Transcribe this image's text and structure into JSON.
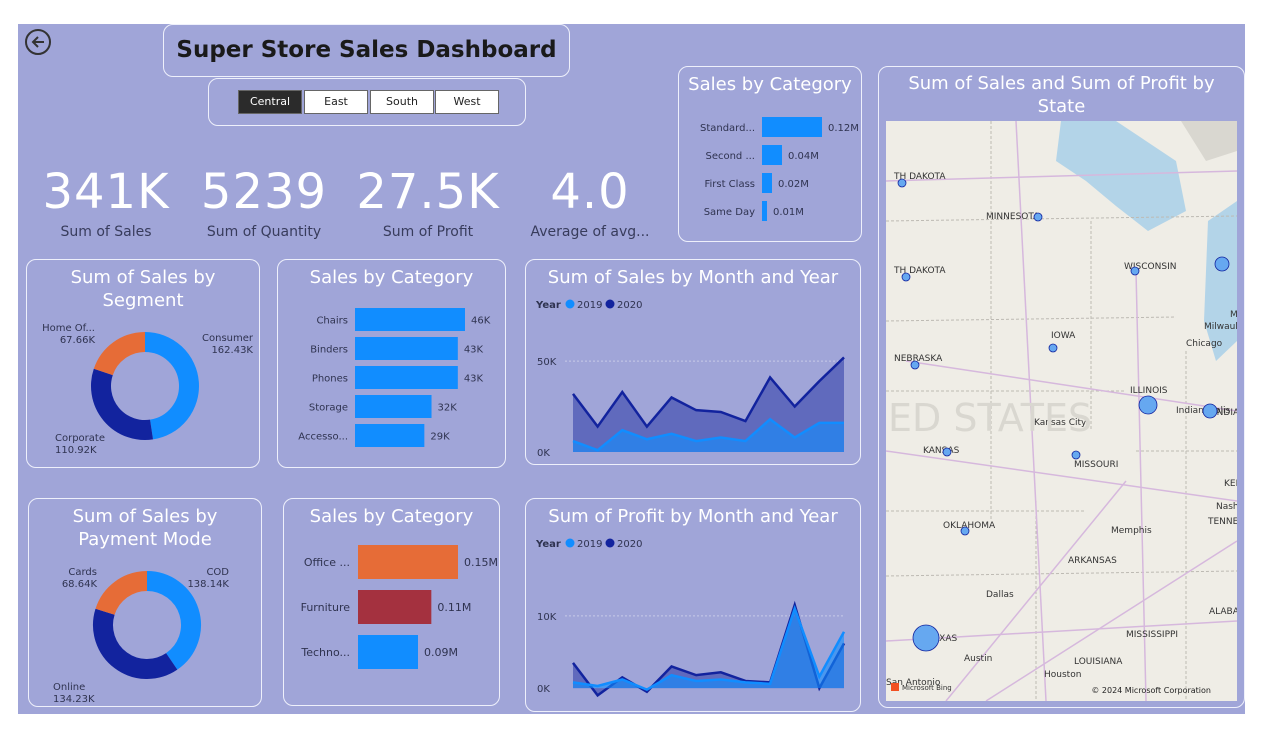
{
  "dashboard": {
    "title": "Super Store Sales Dashboard",
    "regions": [
      "Central",
      "East",
      "South",
      "West"
    ],
    "selected_region": "Central"
  },
  "kpis": [
    {
      "value": "341K",
      "label": "Sum of Sales"
    },
    {
      "value": "5239",
      "label": "Sum of Quantity"
    },
    {
      "value": "27.5K",
      "label": "Sum of Profit"
    },
    {
      "value": "4.0",
      "label": "Average of avg..."
    }
  ],
  "ship_mode": {
    "title": "Sales by Category",
    "items": [
      {
        "label": "Standard...",
        "value": 0.12,
        "text": "0.12M"
      },
      {
        "label": "Second ...",
        "value": 0.04,
        "text": "0.04M"
      },
      {
        "label": "First Class",
        "value": 0.02,
        "text": "0.02M"
      },
      {
        "label": "Same Day",
        "value": 0.01,
        "text": "0.01M"
      }
    ],
    "color": "#118dff"
  },
  "segment": {
    "title": "Sum of Sales by Segment",
    "slices": [
      {
        "name": "Consumer",
        "value": 162.43,
        "text": "162.43K",
        "color": "#118dff"
      },
      {
        "name": "Corporate",
        "value": 110.92,
        "text": "110.92K",
        "color": "#12239e"
      },
      {
        "name": "Home Of...",
        "value": 67.66,
        "text": "67.66K",
        "color": "#e66c37"
      }
    ]
  },
  "sub_category": {
    "title": "Sales by Category",
    "items": [
      {
        "label": "Chairs",
        "value": 46,
        "text": "46K"
      },
      {
        "label": "Binders",
        "value": 43,
        "text": "43K"
      },
      {
        "label": "Phones",
        "value": 43,
        "text": "43K"
      },
      {
        "label": "Storage",
        "value": 32,
        "text": "32K"
      },
      {
        "label": "Accesso...",
        "value": 29,
        "text": "29K"
      }
    ],
    "color": "#118dff"
  },
  "sales_month": {
    "title": "Sum of Sales by Month and Year",
    "legend_title": "Year",
    "series": [
      {
        "name": "2019",
        "color": "#118dff",
        "values": [
          6,
          1,
          12,
          7,
          10,
          6,
          8,
          6,
          18,
          8,
          16,
          16
        ]
      },
      {
        "name": "2020",
        "color": "#12239e",
        "values": [
          32,
          14,
          33,
          14,
          30,
          23,
          22,
          17,
          41,
          25,
          39,
          52
        ]
      }
    ],
    "yticks": [
      "50K",
      "0K"
    ],
    "ylim": [
      0,
      55
    ]
  },
  "payment": {
    "title": "Sum of Sales by Payment Mode",
    "slices": [
      {
        "name": "COD",
        "value": 138.14,
        "text": "138.14K",
        "color": "#118dff"
      },
      {
        "name": "Online",
        "value": 134.23,
        "text": "134.23K",
        "color": "#12239e"
      },
      {
        "name": "Cards",
        "value": 68.64,
        "text": "68.64K",
        "color": "#e66c37"
      }
    ]
  },
  "category": {
    "title": "Sales by Category",
    "items": [
      {
        "label": "Office ...",
        "value": 0.15,
        "text": "0.15M",
        "color": "#e66c37"
      },
      {
        "label": "Furniture",
        "value": 0.11,
        "text": "0.11M",
        "color": "#a4313f"
      },
      {
        "label": "Techno...",
        "value": 0.09,
        "text": "0.09M",
        "color": "#118dff"
      }
    ]
  },
  "profit_month": {
    "title": "Sum of Profit by Month and Year",
    "legend_title": "Year",
    "series": [
      {
        "name": "2019",
        "color": "#118dff",
        "values": [
          0.8,
          0.3,
          1.2,
          -0.2,
          1.8,
          1.0,
          1.2,
          0.8,
          0.6,
          11.0,
          1.6,
          7.8
        ]
      },
      {
        "name": "2020",
        "color": "#12239e",
        "values": [
          3.5,
          -1.0,
          1.5,
          -0.5,
          3.0,
          1.8,
          2.2,
          1.0,
          0.8,
          11.5,
          0.0,
          6.2
        ]
      }
    ],
    "yticks": [
      "10K",
      "0K"
    ],
    "ylim": [
      -1.5,
      14
    ]
  },
  "map": {
    "title": "Sum of Sales and Sum of Profit by State",
    "labels": [
      "TH DAKOTA",
      "MINNESOTA",
      "TH DAKOTA",
      "WISCONSIN",
      "IOWA",
      "NEBRASKA",
      "ILLINOIS",
      "Indianapolis",
      "INDIANA",
      "Kansas City",
      "KANSAS",
      "MISSOURI",
      "OKLAHOMA",
      "Memphis",
      "TENNESSEE",
      "ARKANSAS",
      "Dallas",
      "ALABAMA",
      "TEXAS",
      "MISSISSIPPI",
      "Austin",
      "Houston",
      "LOUISIANA",
      "San Antonio",
      "Milwaukee",
      "Chicago",
      "KENT",
      "Nashvil",
      "M",
      "ED STATES"
    ],
    "bubbles": [
      {
        "state": "North Dakota",
        "size": "small"
      },
      {
        "state": "Minnesota",
        "size": "small"
      },
      {
        "state": "South Dakota",
        "size": "small"
      },
      {
        "state": "Wisconsin",
        "size": "small"
      },
      {
        "state": "Michigan",
        "size": "medium"
      },
      {
        "state": "Iowa",
        "size": "small"
      },
      {
        "state": "Nebraska",
        "size": "small"
      },
      {
        "state": "Illinois",
        "size": "large"
      },
      {
        "state": "Indiana",
        "size": "medium"
      },
      {
        "state": "Kansas",
        "size": "small"
      },
      {
        "state": "Missouri",
        "size": "small"
      },
      {
        "state": "Oklahoma",
        "size": "small"
      },
      {
        "state": "Texas",
        "size": "xlarge"
      }
    ],
    "copyright": "© 2024 Microsoft Corporation",
    "bing": "Microsoft Bing"
  }
}
